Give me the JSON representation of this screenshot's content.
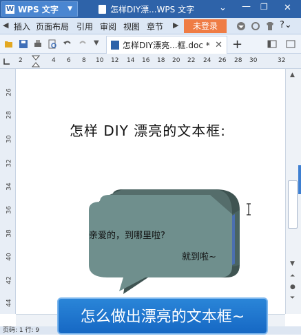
{
  "app": {
    "name": "WPS 文字",
    "doc_title": "怎样DIY漂...WPS 文字"
  },
  "menu": [
    "插入",
    "页面布局",
    "引用",
    "审阅",
    "视图",
    "章节"
  ],
  "login_label": "未登录",
  "tab": {
    "label": "怎样DIY漂亮...框.doc *"
  },
  "ruler": [
    "2",
    "2",
    "4",
    "6",
    "8",
    "10",
    "12",
    "14",
    "16",
    "18",
    "20",
    "22",
    "24",
    "26",
    "28",
    "30",
    "32"
  ],
  "vruler": [
    "26",
    "28",
    "30",
    "32",
    "34",
    "36",
    "38",
    "40",
    "42",
    "44"
  ],
  "document": {
    "heading": "怎样 DIY 漂亮的文本框:",
    "bubble_text1": "亲爱的，到哪里啦?",
    "bubble_text2": "就到啦~"
  },
  "status": "页码: 1   行: 9",
  "caption": "怎么做出漂亮的文本框~",
  "colors": {
    "title_bar": "#2e63a9",
    "bubble_face": "#6f8f8d",
    "bubble_side": "#3f5452",
    "caption_bg": "#1f74cf",
    "login": "#ef7c44"
  }
}
